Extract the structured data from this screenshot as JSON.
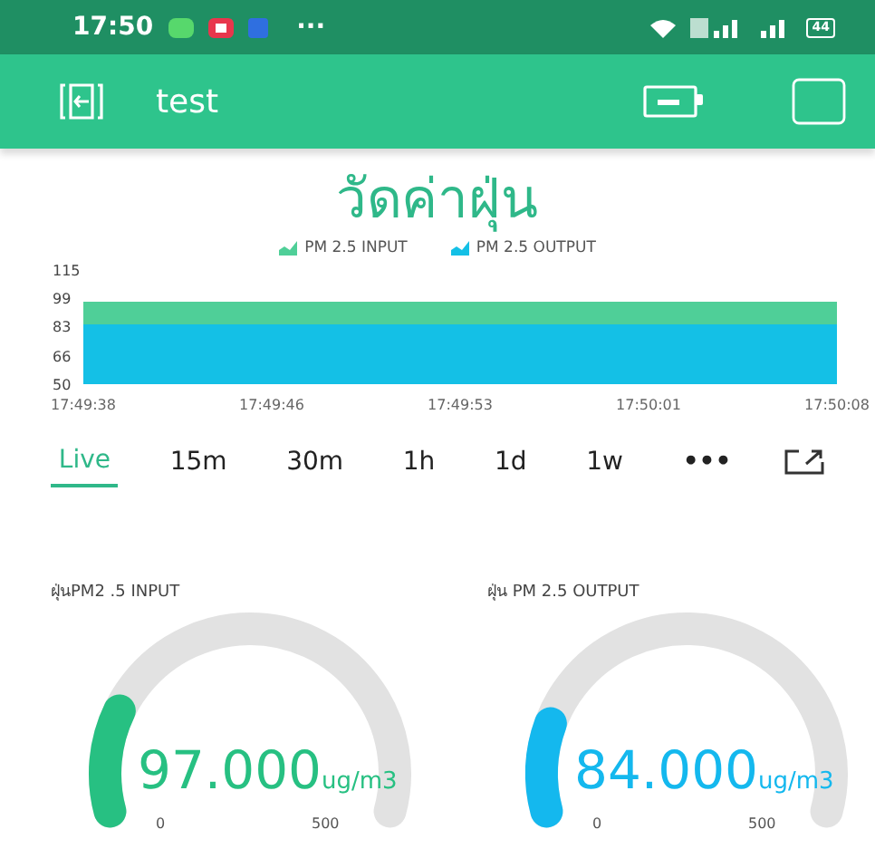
{
  "status_bar": {
    "time": "17:50",
    "more": "···",
    "battery": "44"
  },
  "app_bar": {
    "title": "test"
  },
  "chart": {
    "title": "วัดค่าฝุ่น",
    "chart_data": {
      "type": "area",
      "categories": [
        "17:49:38",
        "17:49:46",
        "17:49:53",
        "17:50:01",
        "17:50:08"
      ],
      "series": [
        {
          "name": "PM 2.5 INPUT",
          "color": "#4fcf98",
          "values": [
            97,
            97,
            97,
            97,
            97
          ]
        },
        {
          "name": "PM 2.5 OUTPUT",
          "color": "#14c0e6",
          "values": [
            84,
            84,
            84,
            84,
            84
          ]
        }
      ],
      "ylim": [
        50,
        115
      ],
      "yticks": [
        50,
        66,
        83,
        99,
        115
      ]
    }
  },
  "periods": [
    {
      "label": "Live",
      "selected": true
    },
    {
      "label": "15m",
      "selected": false
    },
    {
      "label": "30m",
      "selected": false
    },
    {
      "label": "1h",
      "selected": false
    },
    {
      "label": "1d",
      "selected": false
    },
    {
      "label": "1w",
      "selected": false
    }
  ],
  "more": "•••",
  "gauges": [
    {
      "label": "ฝุ่นPM2 .5 INPUT",
      "value": "97.000",
      "unit": "ug/m3",
      "min": "0",
      "max": "500",
      "color": "#27c082"
    },
    {
      "label": "ฝุ่น PM 2.5  OUTPUT",
      "value": "84.000",
      "unit": "ug/m3",
      "min": "0",
      "max": "500",
      "color": "#14b8ee"
    }
  ]
}
